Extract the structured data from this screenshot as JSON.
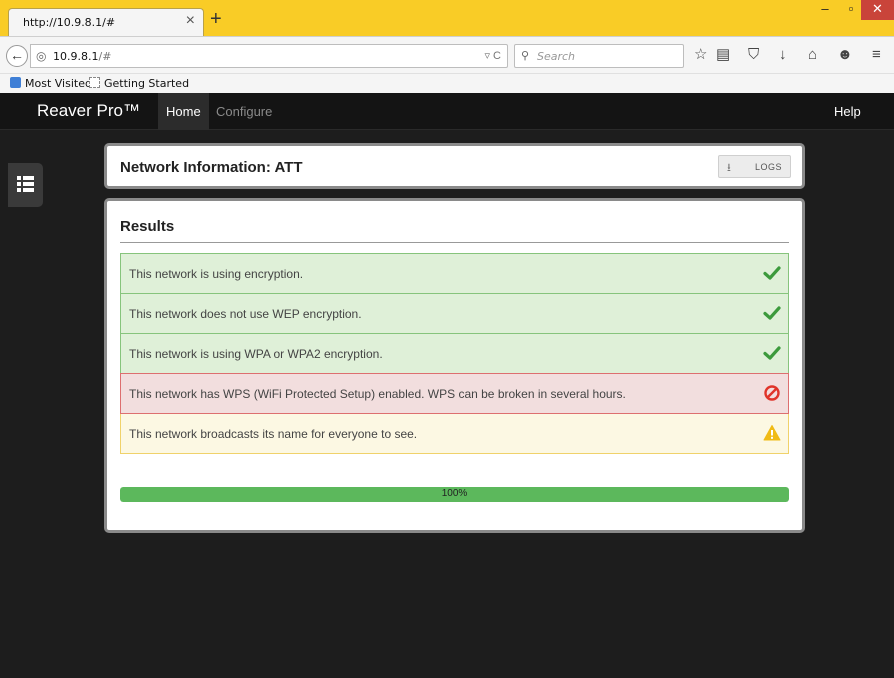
{
  "browser": {
    "tab_title": "http://10.9.8.1/#",
    "tab_close": "×",
    "new_tab": "+",
    "url_host": "10.9.8.1",
    "url_path": "/#",
    "search_placeholder": "Search",
    "window_buttons": {
      "minimize": "–",
      "maximize": "▫",
      "close": "✕"
    },
    "bookmarks": [
      "Most Visited",
      "Getting Started"
    ]
  },
  "app": {
    "brand": "Reaver Pro™",
    "nav": {
      "home": "Home",
      "configure": "Configure",
      "help": "Help"
    }
  },
  "info_panel": {
    "title": "Network Information: ATT",
    "logs_label": "LOGS"
  },
  "results": {
    "title": "Results",
    "rows": [
      {
        "text": "This network is using encryption.",
        "status": "ok",
        "icon": "check-icon"
      },
      {
        "text": "This network does not use WEP encryption.",
        "status": "ok",
        "icon": "check-icon"
      },
      {
        "text": "This network is using WPA or WPA2 encryption.",
        "status": "ok",
        "icon": "check-icon"
      },
      {
        "text": "This network has WPS (WiFi Protected Setup) enabled. WPS can be broken in several hours.",
        "status": "bad",
        "icon": "prohibited-icon"
      },
      {
        "text": "This network broadcasts its name for everyone to see.",
        "status": "warn",
        "icon": "warning-icon"
      }
    ],
    "progress": {
      "value": 1.0,
      "label": "100%"
    }
  },
  "colors": {
    "ok": "#3c9a3c",
    "bad": "#e0342a",
    "warn": "#f0bb16",
    "progress": "#5cb85c"
  }
}
